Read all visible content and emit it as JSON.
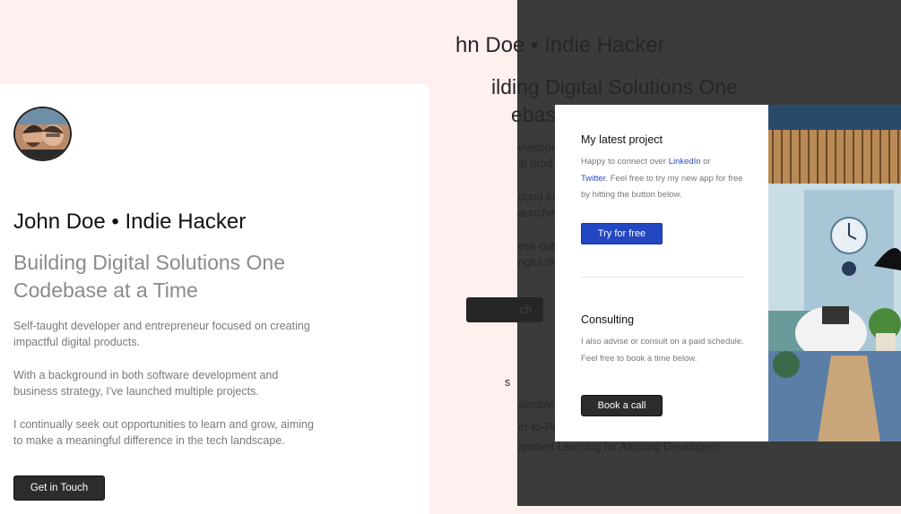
{
  "profile": {
    "name": "John Doe • Indie Hacker",
    "tagline": "Building Digital Solutions One Codebase at a Time",
    "paragraphs": [
      "Self-taught developer and entrepreneur focused on creating impactful digital products.",
      "With a background in both software development and business strategy, I've launched multiple projects.",
      "I continually seek out opportunities to learn and grow, aiming to make a meaningful difference in the tech landscape."
    ],
    "cta_label": "Get in Touch"
  },
  "background_ghost": {
    "name": "hn Doe • Indie Hacker",
    "tagline_1": "ilding Digital Solutions One",
    "tagline_2": "ebase",
    "lines": [
      "eveloper",
      "al prod",
      "ound in",
      "aunche",
      "eek out",
      "ngful dif",
      "ch",
      "s",
      "ainable S",
      "er-to-Pe",
      "amified Learning for Aspiring Developers"
    ]
  },
  "modal": {
    "project": {
      "title": "My latest project",
      "text_pre": "Happy to connect over ",
      "linkedin": "LinkedIn",
      "text_or": " or",
      "twitter": "Twitter",
      "text_post": ". Feel free to try my new app for free by hitting the button below.",
      "button": "Try for free"
    },
    "consulting": {
      "title": "Consulting",
      "text": "I also advise or consult on a paid schedule. Feel free to book a time below.",
      "button": "Book a call"
    }
  },
  "colors": {
    "accent_blue": "#2346c1",
    "dark_button": "#2c2c2c",
    "page_bg": "#fff0f0",
    "overlay": "#3b3b3b"
  }
}
